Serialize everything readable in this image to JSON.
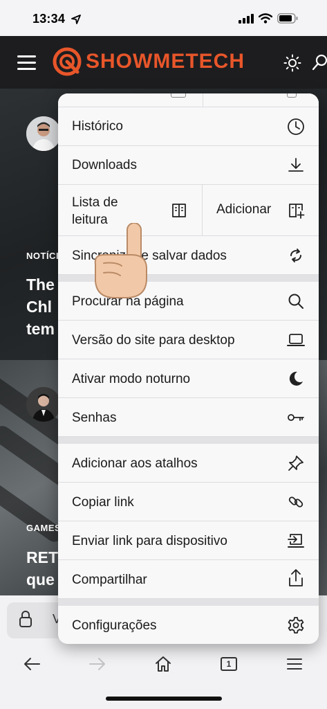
{
  "status_bar": {
    "time": "13:34"
  },
  "site": {
    "logo_text": "SHOWMETECH"
  },
  "background": {
    "article1": {
      "category": "NOTÍCIA",
      "title_lines": [
        "The",
        "Chl",
        "tem"
      ]
    },
    "article2": {
      "category": "GAMES,",
      "title_lines": [
        "RET",
        "que"
      ]
    }
  },
  "url_bar": {
    "text": "V"
  },
  "toolbar": {
    "tab_count": "1"
  },
  "menu": {
    "historico": "Histórico",
    "downloads": "Downloads",
    "lista_leitura_line1": "Lista de",
    "lista_leitura_line2": "leitura",
    "adicionar": "Adicionar",
    "sincronizar": "Sincronizar e salvar dados",
    "procurar": "Procurar na página",
    "versao_desktop": "Versão do site para desktop",
    "modo_noturno": "Ativar modo noturno",
    "senhas": "Senhas",
    "adicionar_atalhos": "Adicionar aos atalhos",
    "copiar_link": "Copiar link",
    "enviar_link": "Enviar link para dispositivo",
    "compartilhar": "Compartilhar",
    "configuracoes": "Configurações"
  },
  "icons": {
    "historico": "clock-icon",
    "downloads": "download-icon",
    "lista_leitura": "book-icon",
    "adicionar": "book-plus-icon",
    "sincronizar": "sync-icon",
    "procurar": "search-icon",
    "versao_desktop": "laptop-icon",
    "modo_noturno": "moon-icon",
    "senhas": "key-icon",
    "adicionar_atalhos": "pin-icon",
    "copiar_link": "link-icon",
    "enviar_link": "send-to-device-icon",
    "compartilhar": "share-icon",
    "configuracoes": "gear-icon"
  },
  "colors": {
    "brand": "#e8562a",
    "menu_bg": "#f8f8f9",
    "header_bg": "#1d1d1f"
  }
}
